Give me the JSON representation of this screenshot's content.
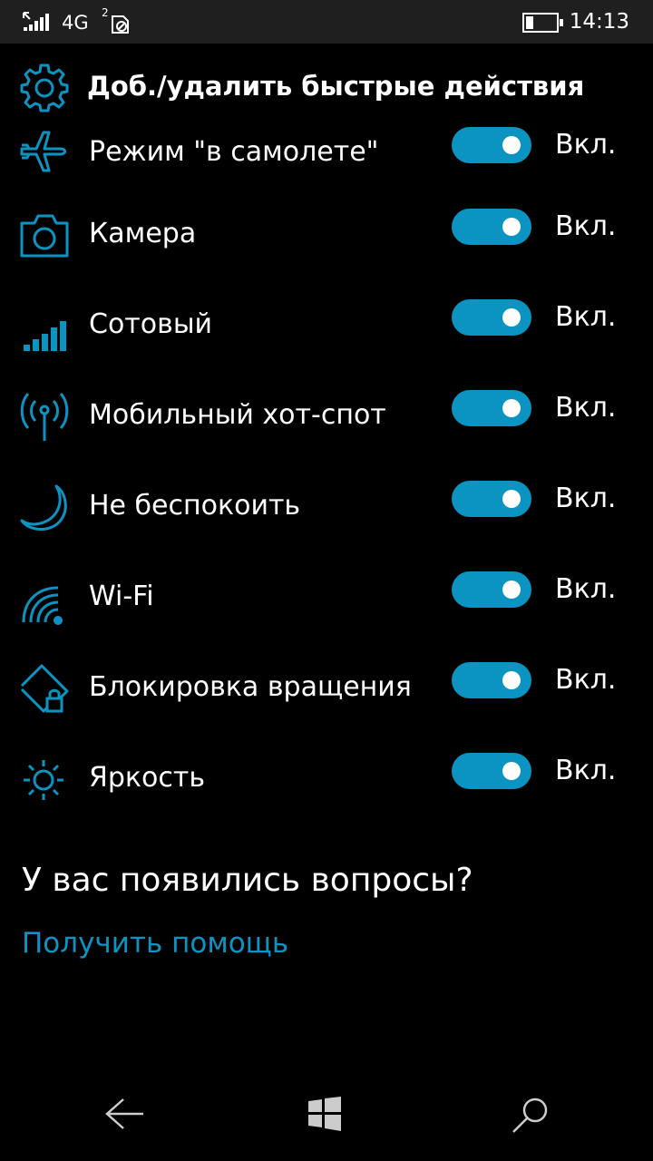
{
  "status_bar": {
    "network": "4G",
    "sim_label": "2",
    "time": "14:13",
    "battery_level": 0.25
  },
  "header": {
    "title": "Доб./удалить быстрые действия"
  },
  "items": [
    {
      "label": "Режим \"в самолете\"",
      "state": "Вкл.",
      "icon": "airplane-icon",
      "on": true
    },
    {
      "label": "Камера",
      "state": "Вкл.",
      "icon": "camera-icon",
      "on": true
    },
    {
      "label": "Сотовый",
      "state": "Вкл.",
      "icon": "cellular-icon",
      "on": true
    },
    {
      "label": "Мобильный хот-спот",
      "state": "Вкл.",
      "icon": "hotspot-icon",
      "on": true
    },
    {
      "label": "Не беспокоить",
      "state": "Вкл.",
      "icon": "moon-icon",
      "on": true
    },
    {
      "label": "Wi-Fi",
      "state": "Вкл.",
      "icon": "wifi-icon",
      "on": true
    },
    {
      "label": "Блокировка вращения",
      "state": "Вкл.",
      "icon": "rotation-lock-icon",
      "on": true
    },
    {
      "label": "Яркость",
      "state": "Вкл.",
      "icon": "brightness-icon",
      "on": true
    }
  ],
  "help": {
    "title": "У вас появились вопросы?",
    "link": "Получить помощь"
  },
  "accent_color": "#0b94c1"
}
